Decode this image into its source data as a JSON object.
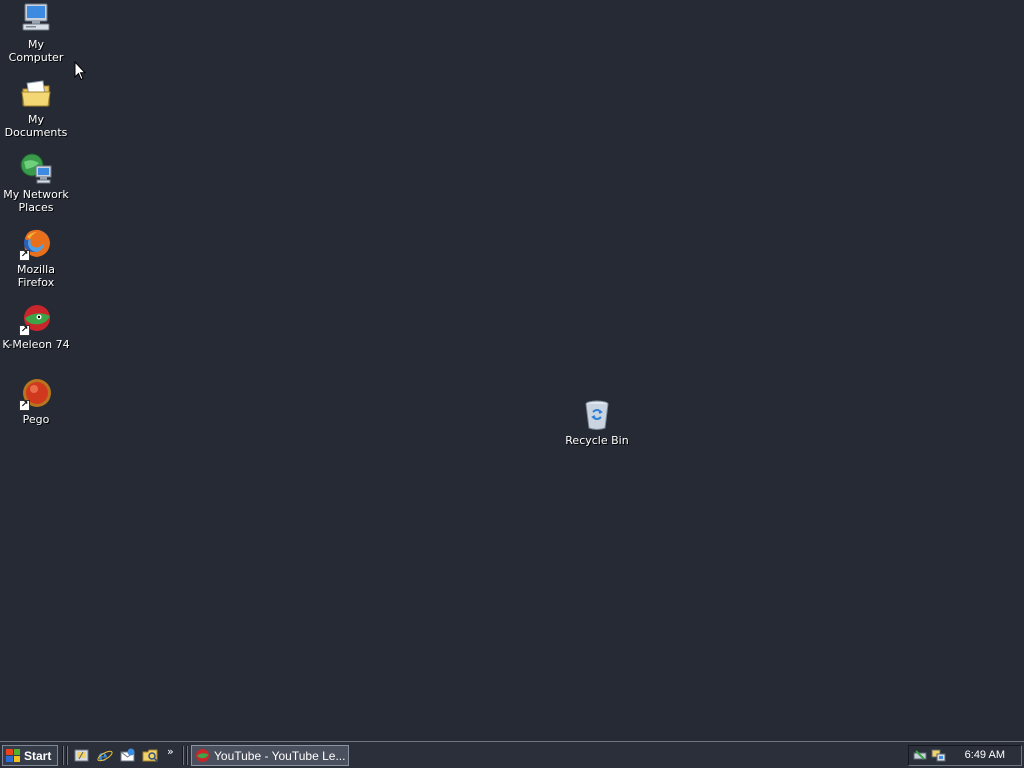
{
  "desktop": {
    "icons": [
      {
        "label": "My Computer",
        "icon": "my-computer-icon"
      },
      {
        "label": "My Documents",
        "icon": "my-documents-icon"
      },
      {
        "label": "My Network Places",
        "icon": "network-places-icon"
      },
      {
        "label": "Mozilla Firefox",
        "icon": "firefox-icon"
      },
      {
        "label": "K-Meleon 74",
        "icon": "k-meleon-icon"
      },
      {
        "label": "Pego",
        "icon": "pego-icon"
      },
      {
        "label": "Recycle Bin",
        "icon": "recycle-bin-icon"
      }
    ],
    "background_color": "#252a35"
  },
  "taskbar": {
    "start_label": "Start",
    "quick_launch": [
      {
        "icon": "show-desktop-icon"
      },
      {
        "icon": "internet-explorer-icon"
      },
      {
        "icon": "outlook-express-icon"
      },
      {
        "icon": "explorer-icon"
      }
    ],
    "more_chevron": "»",
    "tasks": [
      {
        "label": "YouTube - YouTube Le...",
        "icon": "k-meleon-icon"
      }
    ],
    "tray_icons": [
      "safely-remove-hardware-icon",
      "network-icon"
    ],
    "clock": "6:49 AM"
  }
}
